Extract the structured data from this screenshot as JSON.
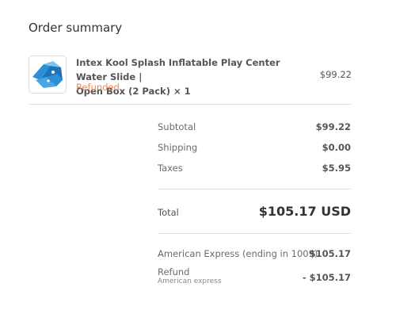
{
  "order_summary": {
    "title": "Order summary",
    "product": {
      "name_line1": "Intex Kool Splash Inflatable Play Center Water Slide |",
      "name_line2": "Open Box (2 Pack) × 1",
      "status": "Refunded",
      "price": "$99.22",
      "thumbnail_icon": "water-slide-image"
    },
    "costs": {
      "subtotal_label": "Subtotal",
      "subtotal_value": "$99.22",
      "shipping_label": "Shipping",
      "shipping_value": "$0.00",
      "taxes_label": "Taxes",
      "taxes_value": "$5.95"
    },
    "total": {
      "label": "Total",
      "value": "$105.17 USD"
    },
    "transactions": {
      "payment_label": "American Express (ending in 1009)",
      "payment_value": "$105.17",
      "refund_label": "Refund",
      "refund_method": "American express",
      "refund_value": "- $105.17"
    },
    "colors": {
      "refunded_status": "#e98b58",
      "divider": "#e1e1e1",
      "thumbnail_blue": "#2f8fd6"
    }
  }
}
